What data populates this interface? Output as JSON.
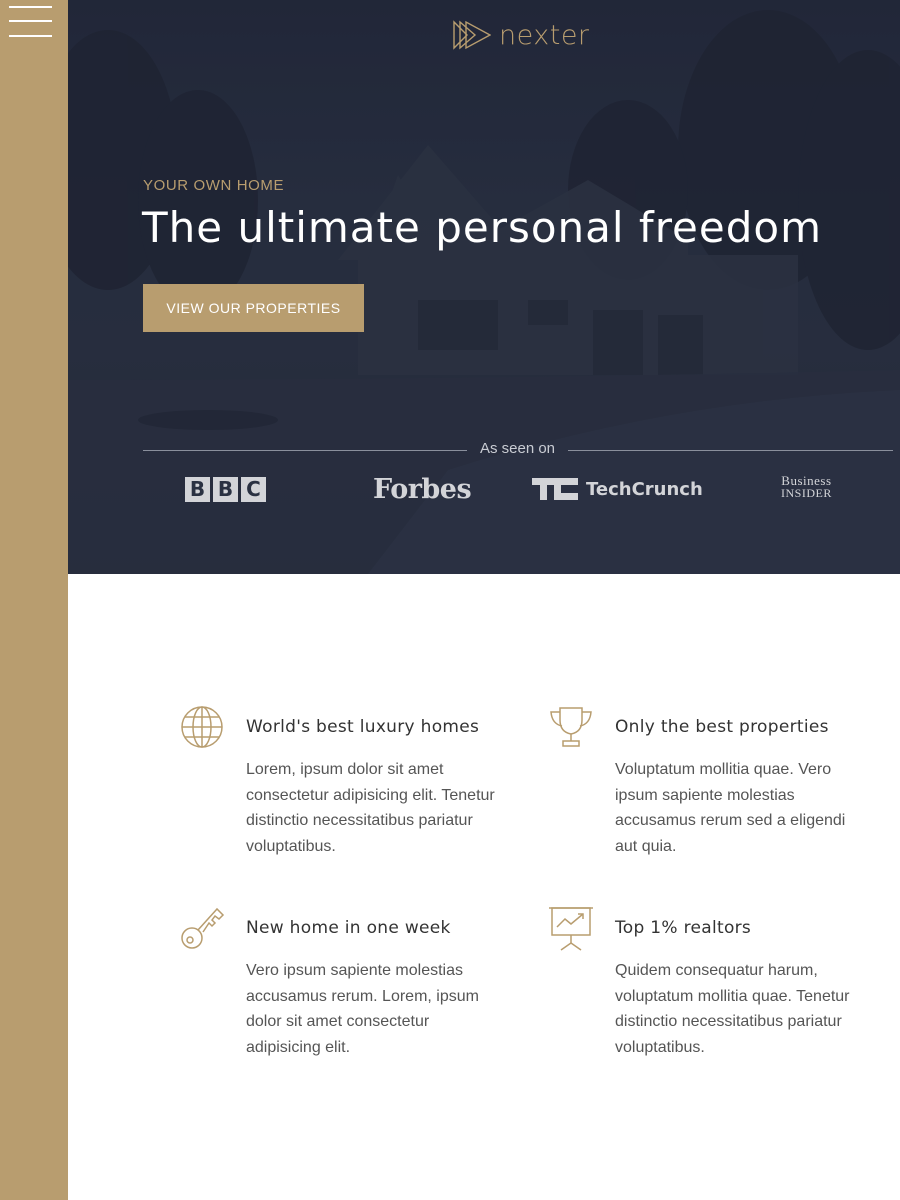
{
  "nav": {
    "menu_icon": "hamburger-menu-icon"
  },
  "brand": {
    "name": "nexter",
    "logo_icon": "triple-triangle-logo-icon",
    "accent_color": "#b89d6f"
  },
  "hero": {
    "eyebrow": "YOUR OWN HOME",
    "headline": "The ultimate personal freedom",
    "cta_label": "VIEW OUR PROPERTIES",
    "seen_on_label": "As seen on",
    "press": {
      "bbc": [
        "B",
        "B",
        "C"
      ],
      "forbes": "Forbes",
      "techcrunch": "TechCrunch",
      "business_insider": [
        "Business",
        "Insider"
      ]
    }
  },
  "features": [
    {
      "icon": "globe-icon",
      "title": "World's best luxury homes",
      "text": "Lorem, ipsum dolor sit amet consectetur adipisicing elit. Tenetur distinctio necessitatibus pariatur voluptatibus."
    },
    {
      "icon": "trophy-icon",
      "title": "Only the best properties",
      "text": "Voluptatum mollitia quae. Vero ipsum sapiente molestias accusamus rerum sed a eligendi aut quia."
    },
    {
      "icon": "key-icon",
      "title": "New home in one week",
      "text": "Vero ipsum sapiente molestias accusamus rerum. Lorem, ipsum dolor sit amet consectetur adipisicing elit."
    },
    {
      "icon": "presentation-chart-icon",
      "title": "Top 1% realtors",
      "text": "Quidem consequatur harum, voluptatum mollitia quae. Tenetur distinctio necessitatibus pariatur voluptatibus."
    }
  ]
}
